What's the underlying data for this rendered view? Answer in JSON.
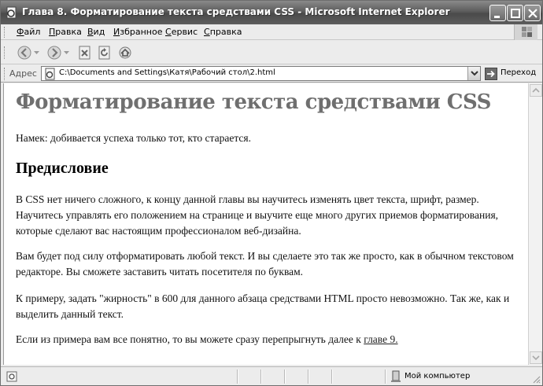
{
  "window": {
    "title": "Глава 8. Форматирование текста средствами CSS - Microsoft Internet Explorer"
  },
  "menu": [
    {
      "hot": "Ф",
      "rest": "айл"
    },
    {
      "hot": "П",
      "rest": "равка"
    },
    {
      "hot": "В",
      "rest": "ид"
    },
    {
      "hot": "И",
      "rest": "збранное"
    },
    {
      "hot": "С",
      "rest": "ервис"
    },
    {
      "hot": "С",
      "rest": "правка"
    }
  ],
  "toolbar": {
    "icons": [
      "back-icon",
      "forward-icon",
      "stop-icon",
      "refresh-icon",
      "home-icon"
    ]
  },
  "address": {
    "label": "Адрес",
    "value": "C:\\Documents and Settings\\Катя\\Рабочий стол\\2.html",
    "go_label": "Переход"
  },
  "page": {
    "title": "Форматирование текста средствами CSS",
    "hint": "Намек: добивается успеха только тот, кто старается.",
    "heading": "Предисловие",
    "para1": "В CSS нет ничего сложного, к концу данной главы вы научитесь изменять цвет текста, шрифт, размер. Научитесь управлять его положением на странице и выучите еще много других приемов форматирования, которые сделают вас настоящим профессионалом веб-дизайна.",
    "para2": "Вам будет под силу отформатировать любой текст. И вы сделаете это так же просто, как в обычном текстовом редакторе. Вы сможете заставить читать посетителя по буквам.",
    "para3": "К примеру, задать \"жирность\" в 600 для данного абзаца средствами HTML просто невозможно. Так же, как и выделить данный текст.",
    "para4_text": "Если из примера вам все понятно, то вы можете сразу перепрыгнуть далее к ",
    "para4_link": "главе 9."
  },
  "status": {
    "zone": "Мой компьютер"
  }
}
